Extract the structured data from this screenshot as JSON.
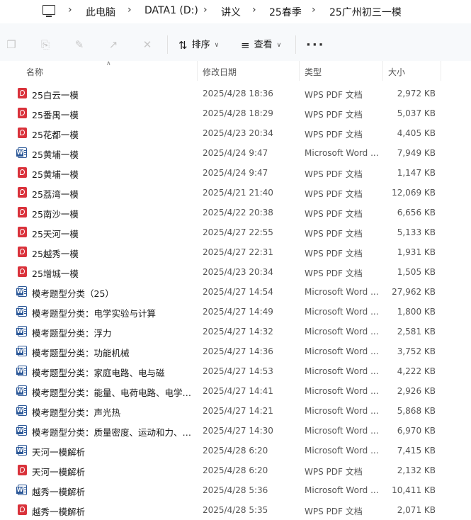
{
  "breadcrumb": {
    "items": [
      "此电脑",
      "DATA1 (D:)",
      "讲义",
      "25春季",
      "25广州初三一模"
    ]
  },
  "toolbar": {
    "sort_label": "排序",
    "view_label": "查看",
    "more_label": "···"
  },
  "columns": {
    "name": "名称",
    "date": "修改日期",
    "type": "类型",
    "size": "大小"
  },
  "files": [
    {
      "icon": "pdf",
      "name": "25白云一模",
      "date": "2025/4/28 18:36",
      "type": "WPS PDF 文档",
      "size": "2,972 KB"
    },
    {
      "icon": "pdf",
      "name": "25番禺一模",
      "date": "2025/4/28 18:29",
      "type": "WPS PDF 文档",
      "size": "5,037 KB"
    },
    {
      "icon": "pdf",
      "name": "25花都一模",
      "date": "2025/4/23 20:34",
      "type": "WPS PDF 文档",
      "size": "4,405 KB"
    },
    {
      "icon": "word",
      "name": "25黄埔一模",
      "date": "2025/4/24 9:47",
      "type": "Microsoft Word ...",
      "size": "7,949 KB"
    },
    {
      "icon": "pdf",
      "name": "25黄埔一模",
      "date": "2025/4/24 9:47",
      "type": "WPS PDF 文档",
      "size": "1,147 KB"
    },
    {
      "icon": "pdf",
      "name": "25荔湾一模",
      "date": "2025/4/21 21:40",
      "type": "WPS PDF 文档",
      "size": "12,069 KB"
    },
    {
      "icon": "pdf",
      "name": "25南沙一模",
      "date": "2025/4/22 20:38",
      "type": "WPS PDF 文档",
      "size": "6,656 KB"
    },
    {
      "icon": "pdf",
      "name": "25天河一模",
      "date": "2025/4/27 22:55",
      "type": "WPS PDF 文档",
      "size": "5,133 KB"
    },
    {
      "icon": "pdf",
      "name": "25越秀一模",
      "date": "2025/4/27 22:31",
      "type": "WPS PDF 文档",
      "size": "1,931 KB"
    },
    {
      "icon": "pdf",
      "name": "25增城一模",
      "date": "2025/4/23 20:34",
      "type": "WPS PDF 文档",
      "size": "1,505 KB"
    },
    {
      "icon": "word",
      "name": "模考题型分类（25）",
      "date": "2025/4/27 14:54",
      "type": "Microsoft Word ...",
      "size": "27,962 KB"
    },
    {
      "icon": "word",
      "name": "模考题型分类：电学实验与计算",
      "date": "2025/4/27 14:49",
      "type": "Microsoft Word ...",
      "size": "1,800 KB"
    },
    {
      "icon": "word",
      "name": "模考题型分类：浮力",
      "date": "2025/4/27 14:32",
      "type": "Microsoft Word ...",
      "size": "2,581 KB"
    },
    {
      "icon": "word",
      "name": "模考题型分类：功能机械",
      "date": "2025/4/27 14:36",
      "type": "Microsoft Word ...",
      "size": "3,752 KB"
    },
    {
      "icon": "word",
      "name": "模考题型分类：家庭电路、电与磁",
      "date": "2025/4/27 14:53",
      "type": "Microsoft Word ...",
      "size": "4,222 KB"
    },
    {
      "icon": "word",
      "name": "模考题型分类：能量、电荷电路、电学选...",
      "date": "2025/4/27 14:41",
      "type": "Microsoft Word ...",
      "size": "2,926 KB"
    },
    {
      "icon": "word",
      "name": "模考题型分类：声光热",
      "date": "2025/4/27 14:21",
      "type": "Microsoft Word ...",
      "size": "5,868 KB"
    },
    {
      "icon": "word",
      "name": "模考题型分类：质量密度、运动和力、压...",
      "date": "2025/4/27 14:30",
      "type": "Microsoft Word ...",
      "size": "6,970 KB"
    },
    {
      "icon": "word",
      "name": "天河一模解析",
      "date": "2025/4/28 6:20",
      "type": "Microsoft Word ...",
      "size": "7,415 KB"
    },
    {
      "icon": "pdf",
      "name": "天河一模解析",
      "date": "2025/4/28 6:20",
      "type": "WPS PDF 文档",
      "size": "2,132 KB"
    },
    {
      "icon": "word",
      "name": "越秀一模解析",
      "date": "2025/4/28 5:36",
      "type": "Microsoft Word ...",
      "size": "10,411 KB"
    },
    {
      "icon": "pdf",
      "name": "越秀一模解析",
      "date": "2025/4/28 5:35",
      "type": "WPS PDF 文档",
      "size": "2,071 KB"
    }
  ]
}
